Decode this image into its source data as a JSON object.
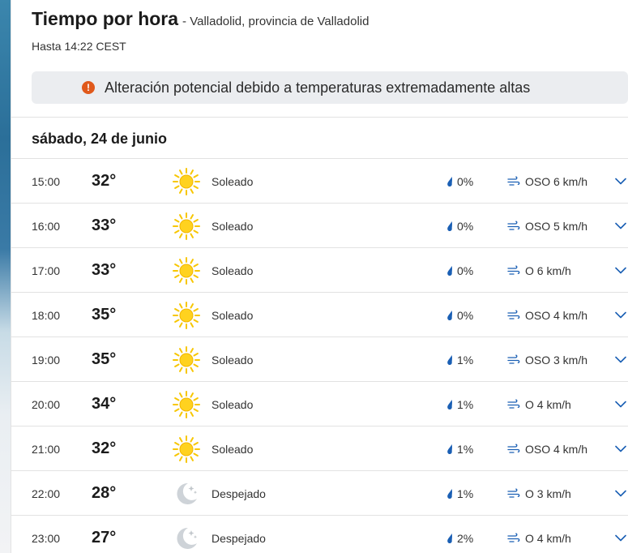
{
  "header": {
    "title": "Tiempo por hora",
    "location": "- Valladolid, provincia de Valladolid",
    "subtitle": "Hasta 14:22 CEST"
  },
  "alert": {
    "text": "Alteración potencial debido a temperaturas extremadamente altas",
    "icon": "exclamation-icon",
    "color": "#e0591b"
  },
  "day": {
    "title": "sábado, 24 de junio"
  },
  "colors": {
    "accent": "#1a5fb4",
    "sun": "#f7c600",
    "moon": "#c8cdd2"
  },
  "hours": [
    {
      "time": "15:00",
      "temp": "32°",
      "icon": "sun-icon",
      "condition": "Soleado",
      "precip": "0%",
      "wind": "OSO 6 km/h"
    },
    {
      "time": "16:00",
      "temp": "33°",
      "icon": "sun-icon",
      "condition": "Soleado",
      "precip": "0%",
      "wind": "OSO 5 km/h"
    },
    {
      "time": "17:00",
      "temp": "33°",
      "icon": "sun-icon",
      "condition": "Soleado",
      "precip": "0%",
      "wind": "O 6 km/h"
    },
    {
      "time": "18:00",
      "temp": "35°",
      "icon": "sun-icon",
      "condition": "Soleado",
      "precip": "0%",
      "wind": "OSO 4 km/h"
    },
    {
      "time": "19:00",
      "temp": "35°",
      "icon": "sun-icon",
      "condition": "Soleado",
      "precip": "1%",
      "wind": "OSO 3 km/h"
    },
    {
      "time": "20:00",
      "temp": "34°",
      "icon": "sun-icon",
      "condition": "Soleado",
      "precip": "1%",
      "wind": "O 4 km/h"
    },
    {
      "time": "21:00",
      "temp": "32°",
      "icon": "sun-icon",
      "condition": "Soleado",
      "precip": "1%",
      "wind": "OSO 4 km/h"
    },
    {
      "time": "22:00",
      "temp": "28°",
      "icon": "moon-icon",
      "condition": "Despejado",
      "precip": "1%",
      "wind": "O 3 km/h"
    },
    {
      "time": "23:00",
      "temp": "27°",
      "icon": "moon-icon",
      "condition": "Despejado",
      "precip": "2%",
      "wind": "O 4 km/h"
    }
  ]
}
